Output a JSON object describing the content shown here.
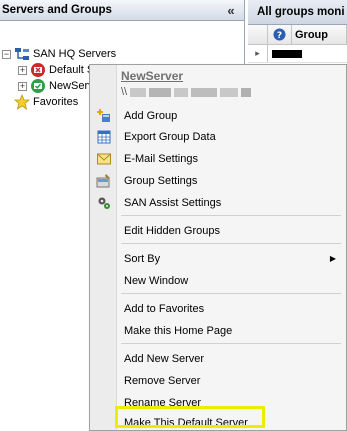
{
  "left_panel": {
    "title": "Servers and Groups",
    "collapse_glyph": "«",
    "tree": {
      "root": "SAN HQ Servers",
      "servers": [
        "Default Server",
        "NewServer"
      ],
      "favorites": "Favorites"
    }
  },
  "right_panel": {
    "tab_title": "All groups moni",
    "column_header": "Group"
  },
  "context_menu": {
    "server_name": "NewServer",
    "address_prefix": "\\\\",
    "items": [
      {
        "label": "Add Group",
        "icon": "add-group-icon"
      },
      {
        "label": "Export Group Data",
        "icon": "table-icon"
      },
      {
        "label": "E-Mail Settings",
        "icon": "envelope-icon"
      },
      {
        "label": "Group Settings",
        "icon": "group-settings-icon"
      },
      {
        "label": "SAN Assist Settings",
        "icon": "gears-icon"
      },
      {
        "label": "Edit Hidden Groups"
      },
      {
        "label": "Sort By",
        "submenu_glyph": "▶"
      },
      {
        "label": "New Window"
      },
      {
        "label": "Add to Favorites"
      },
      {
        "label": "Make this Home Page"
      },
      {
        "label": "Add New Server"
      },
      {
        "label": "Remove Server"
      },
      {
        "label": "Rename Server"
      },
      {
        "label": "Make This Default Server"
      }
    ]
  },
  "colors": {
    "highlight": "#f2ea00",
    "menu_background": "#f5f5f5"
  }
}
